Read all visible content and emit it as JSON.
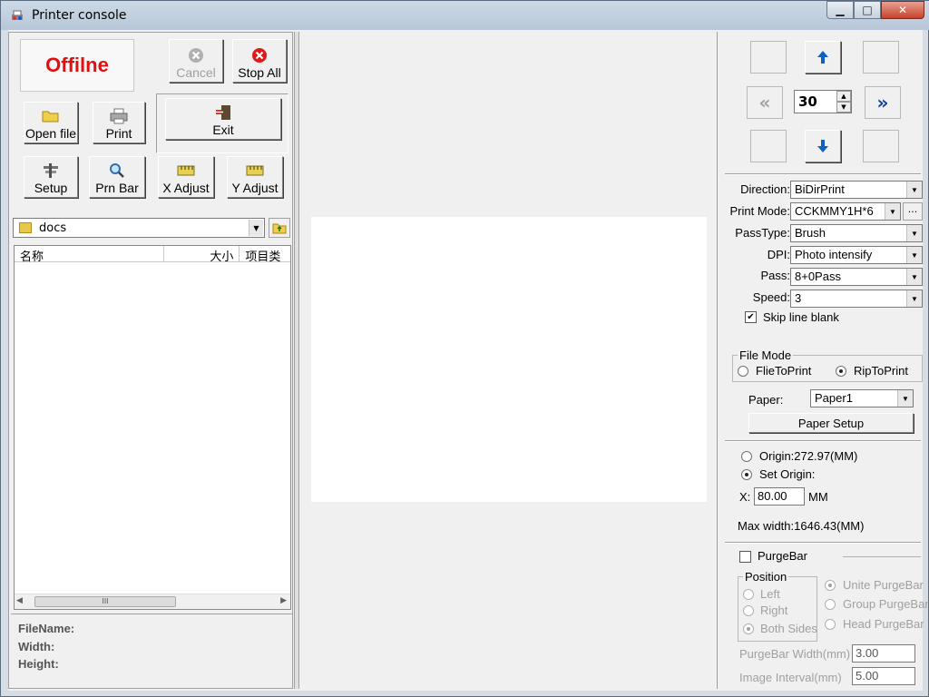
{
  "window": {
    "title": "Printer console",
    "minimize": "▁",
    "maximize": "□",
    "close": "✕"
  },
  "toolbar": {
    "status": "Offilne",
    "cancel": "Cancel",
    "stop_all": "Stop All",
    "open_file": "Open file",
    "print": "Print",
    "exit": "Exit",
    "setup": "Setup",
    "prn_bar": "Prn Bar",
    "x_adjust": "X Adjust",
    "y_adjust": "Y Adjust"
  },
  "browser": {
    "folder": "docs",
    "columns": [
      "名称",
      "大小",
      "项目类"
    ],
    "scroll_thumb": "III"
  },
  "fileinfo": {
    "filename": "FileName:",
    "width": "Width:",
    "height": "Height:"
  },
  "nav": {
    "step": "30"
  },
  "settings": {
    "direction_label": "Direction:",
    "direction": "BiDirPrint",
    "printmode_label": "Print Mode:",
    "printmode": "CCKMMY1H*6",
    "more": "...",
    "passtype_label": "PassType:",
    "passtype": "Brush",
    "dpi_label": "DPI:",
    "dpi": "Photo intensify",
    "pass_label": "Pass:",
    "pass": "8+0Pass",
    "speed_label": "Speed:",
    "speed": "3",
    "skip_blank": "Skip line blank"
  },
  "filemode": {
    "title": "File Mode",
    "file_to_print": "FlieToPrint",
    "rip_to_print": "RipToPrint",
    "paper_label": "Paper:",
    "paper": "Paper1",
    "paper_setup": "Paper Setup"
  },
  "origin": {
    "origin": "Origin:272.97(MM)",
    "set_origin": "Set Origin:",
    "x_label": "X:",
    "x_value": "80.00",
    "unit": "MM",
    "max_width": "Max width:1646.43(MM)"
  },
  "purge": {
    "purgebar": "PurgeBar",
    "position_title": "Position",
    "left": "Left",
    "right": "Right",
    "both_sides": "Both Sides",
    "unite": "Unite PurgeBar",
    "group": "Group PurgeBar",
    "head": "Head PurgeBar",
    "width_label": "PurgeBar Width(mm)",
    "width": "3.00",
    "interval_label": "Image Interval(mm)",
    "interval": "5.00"
  },
  "colors": {
    "status": "#e01010",
    "nav_arrow": "#1060c0"
  }
}
